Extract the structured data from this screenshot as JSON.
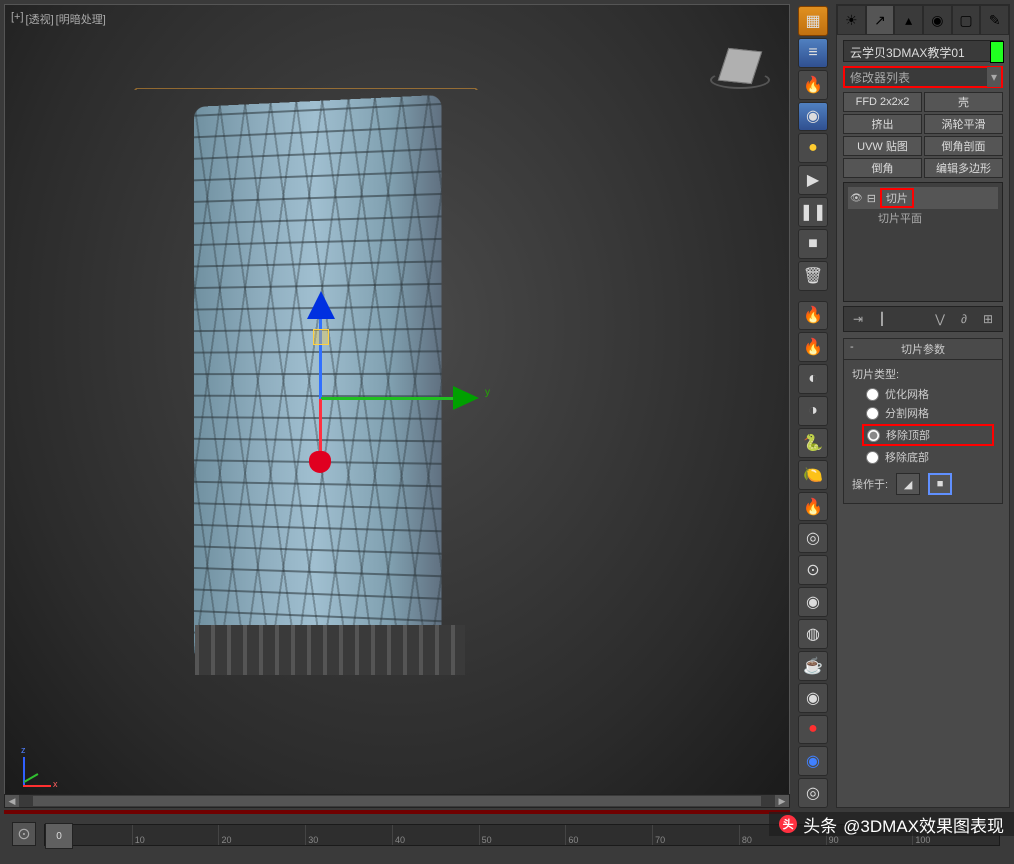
{
  "viewport": {
    "labels": [
      "[+]",
      "[透视]",
      "[明暗处理]"
    ]
  },
  "object_name": "云学贝3DMAX教学01",
  "modifier_dropdown": "修改器列表",
  "mod_buttons": [
    "FFD 2x2x2",
    "壳",
    "挤出",
    "涡轮平滑",
    "UVW 贴图",
    "倒角剖面",
    "倒角",
    "编辑多边形"
  ],
  "stack": {
    "modifier": "切片",
    "sub": "切片平面"
  },
  "rollout": {
    "title": "切片参数",
    "type_label": "切片类型:",
    "options": [
      "优化网格",
      "分割网格",
      "移除顶部",
      "移除底部"
    ],
    "selected": "移除顶部",
    "operate_label": "操作于:"
  },
  "timeline": {
    "current": "0",
    "ticks": [
      "0",
      "10",
      "20",
      "30",
      "40",
      "50",
      "60",
      "70",
      "80",
      "90",
      "100"
    ]
  },
  "watermark": {
    "prefix": "头条",
    "text": "@3DMAX效果图表现"
  },
  "panel_tabs": [
    "☀",
    "↗",
    "▴",
    "◉",
    "▢",
    "✎"
  ],
  "vtool_icons": [
    "▦",
    "≡",
    "🔥",
    "◉",
    "●",
    "▶",
    "❚❚",
    "■",
    "🗑",
    "🔥",
    "🔥",
    "◐",
    "◑",
    "🐍",
    "🍋",
    "🔥",
    "◎",
    "⊙",
    "◉",
    "◍",
    "☕",
    "◉",
    "●",
    "◉",
    "◎",
    "◌"
  ],
  "stack_toolbar": [
    "⇥",
    "┃",
    "⋁",
    "∂",
    "⊞"
  ]
}
